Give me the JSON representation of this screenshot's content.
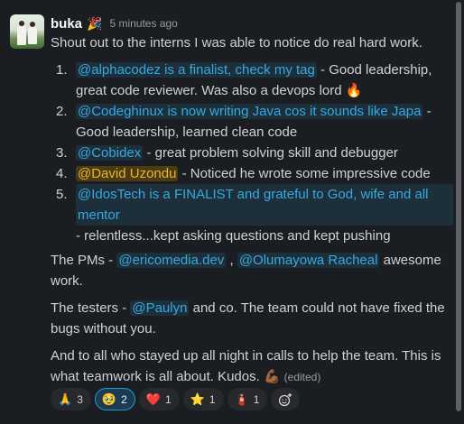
{
  "message": {
    "author": "buka",
    "status_emoji": "🎉",
    "time": "5 minutes ago",
    "intro": "Shout out to the interns I was able to notice do real hard work.",
    "items": [
      {
        "number": "1.",
        "mention": "@alphacodez is a finalist, check my tag",
        "text1": " - Good leadership,",
        "text2": "great code reviewer. Was also a devops lord",
        "emoji": "🔥"
      },
      {
        "number": "2.",
        "mention": "@Codeghinux is now writing Java cos it sounds like Japa",
        "text1": " -",
        "text2": "Good leadership, learned clean code"
      },
      {
        "number": "3.",
        "mention": "@Cobidex",
        "text1": " - great problem solving skill and debugger"
      },
      {
        "number": "4.",
        "mention": "@David Uzondu",
        "text1": " - Noticed he wrote some impressive code"
      },
      {
        "number": "5.",
        "mention_line1": "@IdosTech is a FINALIST and grateful to God, wife and all",
        "mention_line2": "mentor",
        "text2": "- relentless...kept asking questions and kept pushing"
      }
    ],
    "pms": {
      "prefix": "The PMs - ",
      "m1": "@ericomedia.dev",
      "sep": " , ",
      "m2": "@Olumayowa Racheal",
      "suffix": " awesome",
      "line2": "work."
    },
    "testers": {
      "prefix": "The testers - ",
      "m1": "@Paulyn",
      "suffix": " and co. The team could not have fixed the",
      "line2": "bugs without you."
    },
    "closing": {
      "line1": "And to all who stayed up all night in calls to help the team. This is",
      "line2": "what teamwork is all about. Kudos.",
      "emoji": "💪🏾",
      "edited": "(edited)"
    }
  },
  "reactions": [
    {
      "emoji": "🙏",
      "count": "3",
      "active": false
    },
    {
      "emoji": "🥹",
      "count": "2",
      "active": true
    },
    {
      "emoji": "❤️",
      "count": "1",
      "active": false
    },
    {
      "emoji": "⭐",
      "count": "1",
      "active": false
    },
    {
      "emoji": "🧯",
      "count": "1",
      "active": false
    }
  ],
  "colors": {
    "background": "#1a1d21",
    "mention": "#36a9e0",
    "mention_bg": "#1d2f3a",
    "highlight_mention": "#e8b53a",
    "active_reaction": "#1d9bd1"
  }
}
